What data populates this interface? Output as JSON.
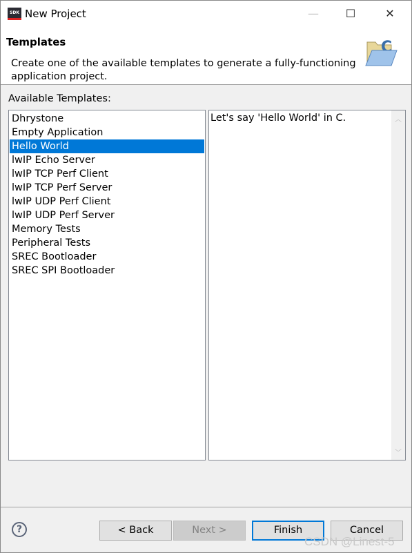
{
  "window": {
    "title": "New Project",
    "app_icon": "SDK",
    "minimize": "—",
    "maximize": "☐",
    "close": "✕"
  },
  "header": {
    "title": "Templates",
    "description": "Create one of the available templates to generate a fully-functioning application project."
  },
  "templates": {
    "label": "Available Templates:",
    "items": [
      "Dhrystone",
      "Empty Application",
      "Hello World",
      "lwIP Echo Server",
      "lwIP TCP Perf Client",
      "lwIP TCP Perf Server",
      "lwIP UDP Perf Client",
      "lwIP UDP Perf Server",
      "Memory Tests",
      "Peripheral Tests",
      "SREC Bootloader",
      "SREC SPI Bootloader"
    ],
    "selected": "Hello World",
    "description": "Let's say 'Hello World' in C."
  },
  "buttons": {
    "help": "?",
    "back": "< Back",
    "next": "Next >",
    "finish": "Finish",
    "cancel": "Cancel"
  },
  "watermark": "CSDN @Linest-5"
}
